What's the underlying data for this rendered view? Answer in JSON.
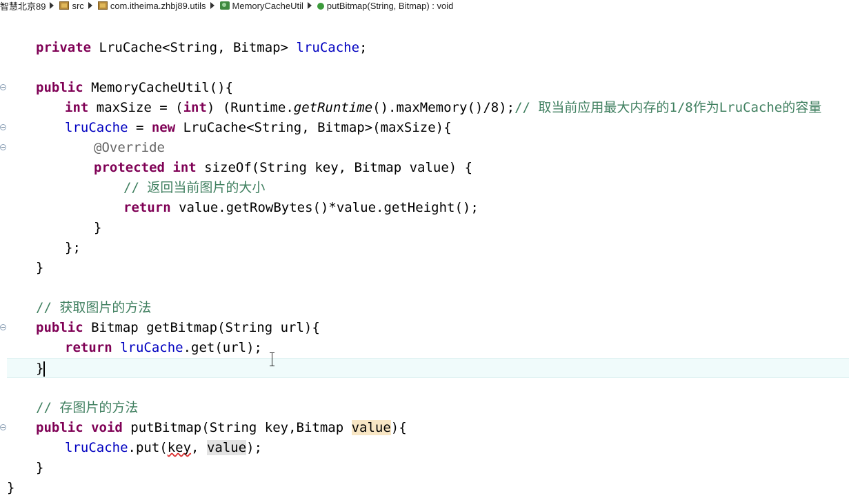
{
  "breadcrumb": {
    "project": "智慧北京89",
    "folder": "src",
    "package": "com.itheima.zhbj89.utils",
    "class": "MemoryCacheUtil",
    "method": "putBitmap(String, Bitmap) : void"
  },
  "code": {
    "l_private": "private",
    "l_lrucache_decl_type": " LruCache<String, Bitmap> ",
    "l_lrucache_field": "lruCache",
    "semicolon": ";",
    "public": "public",
    "ctor_sig": " MemoryCacheUtil(){",
    "int": "int",
    "maxsize_a": " maxSize = (",
    "maxsize_b": ") (Runtime.",
    "getRuntime": "getRuntime",
    "maxsize_c": "().maxMemory()/8);",
    "comment_maxsize": "// 取当前应用最大内存的1/8作为LruCache的容量",
    "assign_field": "lruCache",
    "assign_a": " = ",
    "new": "new",
    "assign_b": " LruCache<String, Bitmap>(maxSize){",
    "override": "@Override",
    "protected": "protected",
    "sizeof_sig": " sizeOf(String key, Bitmap value) {",
    "comment_size": "// 返回当前图片的大小",
    "return": "return",
    "return_size": " value.getRowBytes()*value.getHeight();",
    "close_brace": "}",
    "close_anon": "};",
    "comment_get": "// 获取图片的方法",
    "getbitmap_sig": " Bitmap getBitmap(String url){",
    "return_get_b": ".get(url);",
    "comment_put": "// 存图片的方法",
    "void": "void",
    "putbitmap_sig": " putBitmap(String key,Bitmap ",
    "value": "value",
    "put_open": "){",
    "put_call_a": ".put(",
    "key": "key",
    "comma": ", ",
    "put_call_end": ");"
  },
  "colors": {
    "keyword": "#7f0055",
    "field": "#0000c0",
    "comment": "#3f7f5f",
    "annotation": "#646464",
    "current_line": "#f0fbfb"
  }
}
